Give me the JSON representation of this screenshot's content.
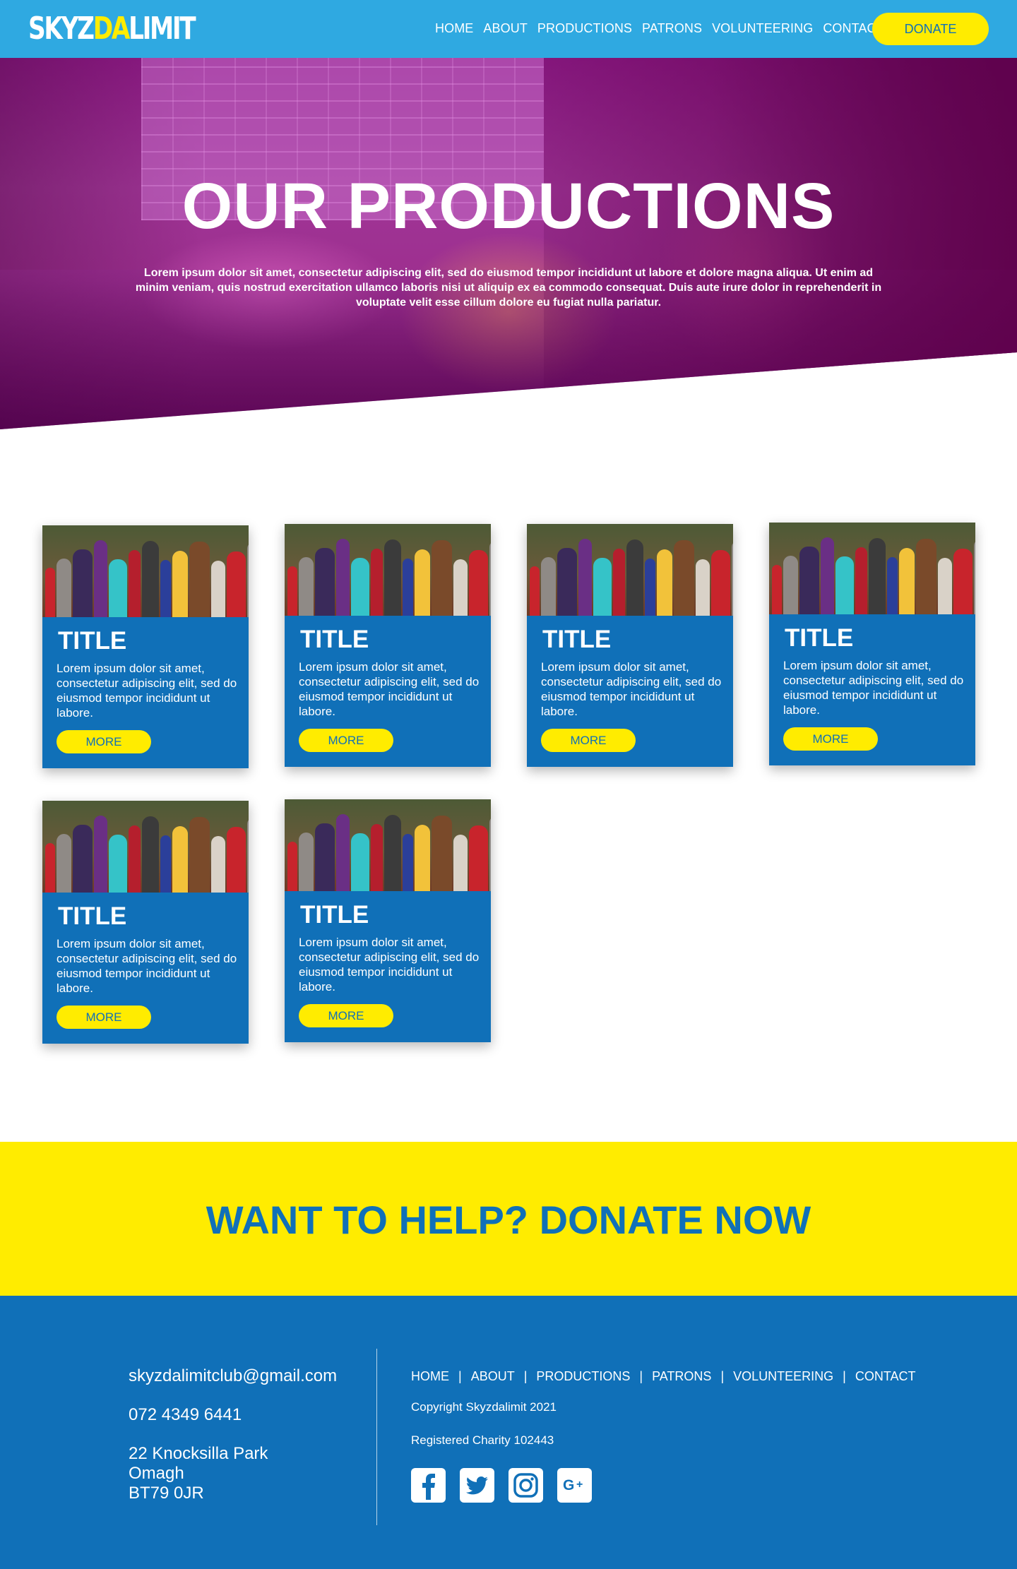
{
  "nav": {
    "logo_part1": "SKYZ",
    "logo_part2": "DA",
    "logo_part3": "LIMIT",
    "items": [
      "HOME",
      "ABOUT",
      "PRODUCTIONS",
      "PATRONS",
      "VOLUNTEERING",
      "CONTACT"
    ],
    "donate_label": "DONATE"
  },
  "hero": {
    "title": "OUR PRODUCTIONS",
    "text": "Lorem ipsum dolor sit amet, consectetur adipiscing elit, sed do eiusmod tempor incididunt ut labore et dolore magna aliqua. Ut enim ad minim veniam, quis nostrud exercitation ullamco laboris nisi ut aliquip ex ea commodo consequat. Duis aute irure dolor in reprehenderit in voluptate velit esse cillum dolore eu fugiat nulla pariatur."
  },
  "cards": [
    {
      "title": "TITLE",
      "text": "Lorem ipsum dolor sit amet, consectetur adipiscing elit, sed do eiusmod tempor incididunt ut labore.",
      "button": "MORE"
    },
    {
      "title": "TITLE",
      "text": "Lorem ipsum dolor sit amet, consectetur adipiscing elit, sed do eiusmod tempor incididunt ut labore.",
      "button": "MORE"
    },
    {
      "title": "TITLE",
      "text": "Lorem ipsum dolor sit amet, consectetur adipiscing elit, sed do eiusmod tempor incididunt ut labore.",
      "button": "MORE"
    },
    {
      "title": "TITLE",
      "text": "Lorem ipsum dolor sit amet, consectetur adipiscing elit, sed do eiusmod tempor incididunt ut labore.",
      "button": "MORE"
    },
    {
      "title": "TITLE",
      "text": "Lorem ipsum dolor sit amet, consectetur adipiscing elit, sed do eiusmod tempor incididunt ut labore.",
      "button": "MORE"
    },
    {
      "title": "TITLE",
      "text": "Lorem ipsum dolor sit amet, consectetur adipiscing elit, sed do eiusmod tempor incididunt ut labore.",
      "button": "MORE"
    }
  ],
  "donate_band": {
    "text": "WANT TO HELP? DONATE NOW"
  },
  "footer": {
    "email": "skyzdalimitclub@gmail.com",
    "phone": "072 4349 6441",
    "address_line1": "22 Knocksilla Park",
    "address_line2": "Omagh",
    "address_line3": "BT79 0JR",
    "menu": [
      "HOME",
      "ABOUT",
      "PRODUCTIONS",
      "PATRONS",
      "VOLUNTEERING",
      "CONTACT"
    ],
    "separator": "|",
    "copyright": "Copyright Skyzdalimit 2021",
    "charity": "Registered Charity 102443",
    "social": [
      "facebook-icon",
      "twitter-icon",
      "instagram-icon",
      "google-plus-icon"
    ]
  },
  "colors": {
    "nav_bg": "#2fa9e1",
    "accent_yellow": "#ffec00",
    "brand_blue": "#1070b8",
    "hero_overlay": "#9d2f8f"
  }
}
